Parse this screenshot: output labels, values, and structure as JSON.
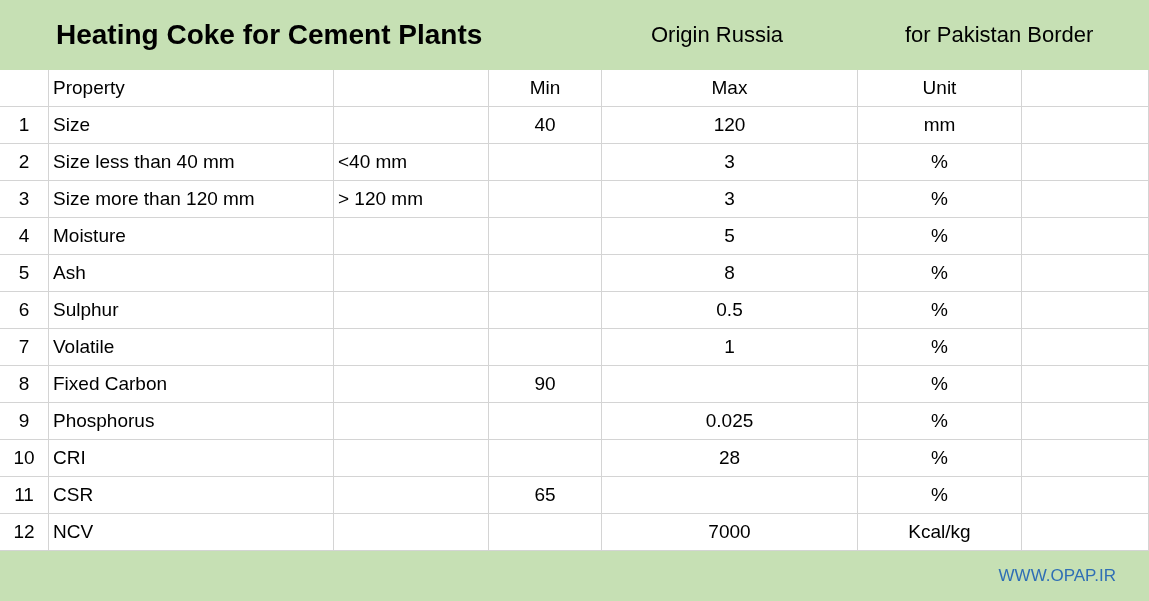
{
  "title": {
    "heading": "Heating Coke  for Cement Plants",
    "origin": "Origin Russia",
    "destination": "for Pakistan Border"
  },
  "header": {
    "property": "Property",
    "min": "Min",
    "max": "Max",
    "unit": "Unit"
  },
  "rows": [
    {
      "number": "1",
      "property": "Size",
      "min": "40",
      "max": "120",
      "unit": "mm"
    },
    {
      "number": "2",
      "property": "Size less than 40 mm",
      "note": "<40 mm",
      "max": "3",
      "unit": "%"
    },
    {
      "number": "3",
      "property": "Size more than 120 mm",
      "note": "> 120 mm",
      "max": "3",
      "unit": "%"
    },
    {
      "number": "4",
      "property": "Moisture",
      "max": "5",
      "unit": "%"
    },
    {
      "number": "5",
      "property": "Ash",
      "max": "8",
      "unit": "%"
    },
    {
      "number": "6",
      "property": "Sulphur",
      "max": "0.5",
      "unit": "%"
    },
    {
      "number": "7",
      "property": "Volatile",
      "max": "1",
      "unit": "%"
    },
    {
      "number": "8",
      "property": "Fixed Carbon",
      "min": "90",
      "unit": "%"
    },
    {
      "number": "9",
      "property": "Phosphorus",
      "max": "0.025",
      "unit": "%"
    },
    {
      "number": "10",
      "property": "CRI",
      "max": "28",
      "unit": "%"
    },
    {
      "number": "11",
      "property": "CSR",
      "min": "65",
      "unit": "%"
    },
    {
      "number": "12",
      "property": "NCV",
      "max": "7000",
      "unit": "Kcal/kg"
    }
  ],
  "footer": {
    "website": "WWW.OPAP.IR"
  }
}
